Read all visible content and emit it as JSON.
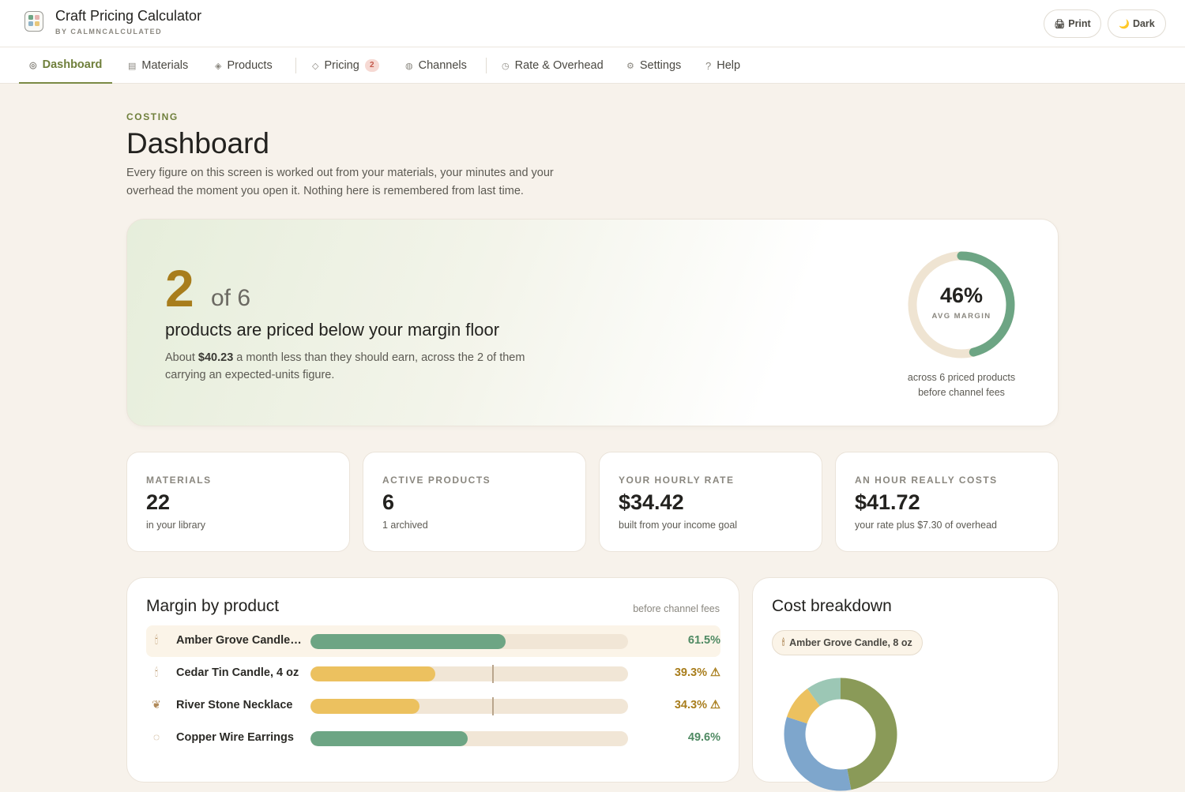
{
  "app": {
    "title": "Craft Pricing Calculator",
    "byline": "BY CALMNCALCULATED",
    "print_label": "Print",
    "dark_label": "Dark"
  },
  "nav": {
    "items": [
      {
        "label": "Dashboard",
        "icon": "dashboard-icon"
      },
      {
        "label": "Materials",
        "icon": "list-icon"
      },
      {
        "label": "Products",
        "icon": "diamond-icon"
      },
      {
        "label": "Pricing",
        "icon": "tag-icon",
        "badge": "2"
      },
      {
        "label": "Channels",
        "icon": "globe-icon"
      },
      {
        "label": "Rate & Overhead",
        "icon": "clock-icon"
      },
      {
        "label": "Settings",
        "icon": "gear-icon"
      },
      {
        "label": "Help",
        "icon": "help-icon"
      }
    ]
  },
  "page": {
    "eyebrow": "COSTING",
    "title": "Dashboard",
    "intro": "Every figure on this screen is worked out from your materials, your minutes and your overhead the moment you open it. Nothing here is remembered from last time."
  },
  "hero": {
    "count": "2",
    "of_total": "of 6",
    "headline": "products are priced below your margin floor",
    "desc_prefix": "About ",
    "desc_amount": "$40.23",
    "desc_suffix": " a month less than they should earn, across the 2 of them carrying an expected-units figure.",
    "avg_margin": "46%",
    "avg_margin_value": 46,
    "avg_margin_label": "AVG MARGIN",
    "note_line1": "across 6 priced products",
    "note_line2": "before channel fees"
  },
  "stats": [
    {
      "label": "MATERIALS",
      "value": "22",
      "sub": "in your library"
    },
    {
      "label": "ACTIVE PRODUCTS",
      "value": "6",
      "sub": "1 archived"
    },
    {
      "label": "YOUR HOURLY RATE",
      "value": "$34.42",
      "sub": "built from your income goal"
    },
    {
      "label": "AN HOUR REALLY COSTS",
      "value": "$41.72",
      "sub": "your rate plus $7.30 of overhead"
    }
  ],
  "margins": {
    "title": "Margin by product",
    "note": "before channel fees",
    "floor": 57.5,
    "scale_max": 100,
    "products": [
      {
        "name": "Amber Grove Candle, 8 oz",
        "icon": "candle-icon",
        "margin": 61.5,
        "label": "61.5%",
        "below_floor": false,
        "selected": true
      },
      {
        "name": "Cedar Tin Candle, 4 oz",
        "icon": "candle-icon",
        "margin": 39.3,
        "label": "39.3%",
        "below_floor": true,
        "selected": false
      },
      {
        "name": "River Stone Necklace",
        "icon": "necklace-icon",
        "margin": 34.3,
        "label": "34.3%",
        "below_floor": true,
        "selected": false
      },
      {
        "name": "Copper Wire Earrings",
        "icon": "earring-icon",
        "margin": 49.6,
        "label": "49.6%",
        "below_floor": false,
        "selected": false
      }
    ]
  },
  "cost": {
    "title": "Cost breakdown",
    "selected_product": "Amber Grove Candle, 8 oz",
    "segments": [
      {
        "color": "#8a9a58",
        "value": 47
      },
      {
        "color": "#7ea6cc",
        "value": 33
      },
      {
        "color": "#ecc15f",
        "value": 10
      },
      {
        "color": "#9cc7b5",
        "value": 10
      }
    ]
  },
  "colors": {
    "accent": "#6f7f3b",
    "good": "#6da584",
    "warn": "#ecc15f",
    "warn_text": "#a87d1c",
    "ring_track": "#efe4d2"
  }
}
